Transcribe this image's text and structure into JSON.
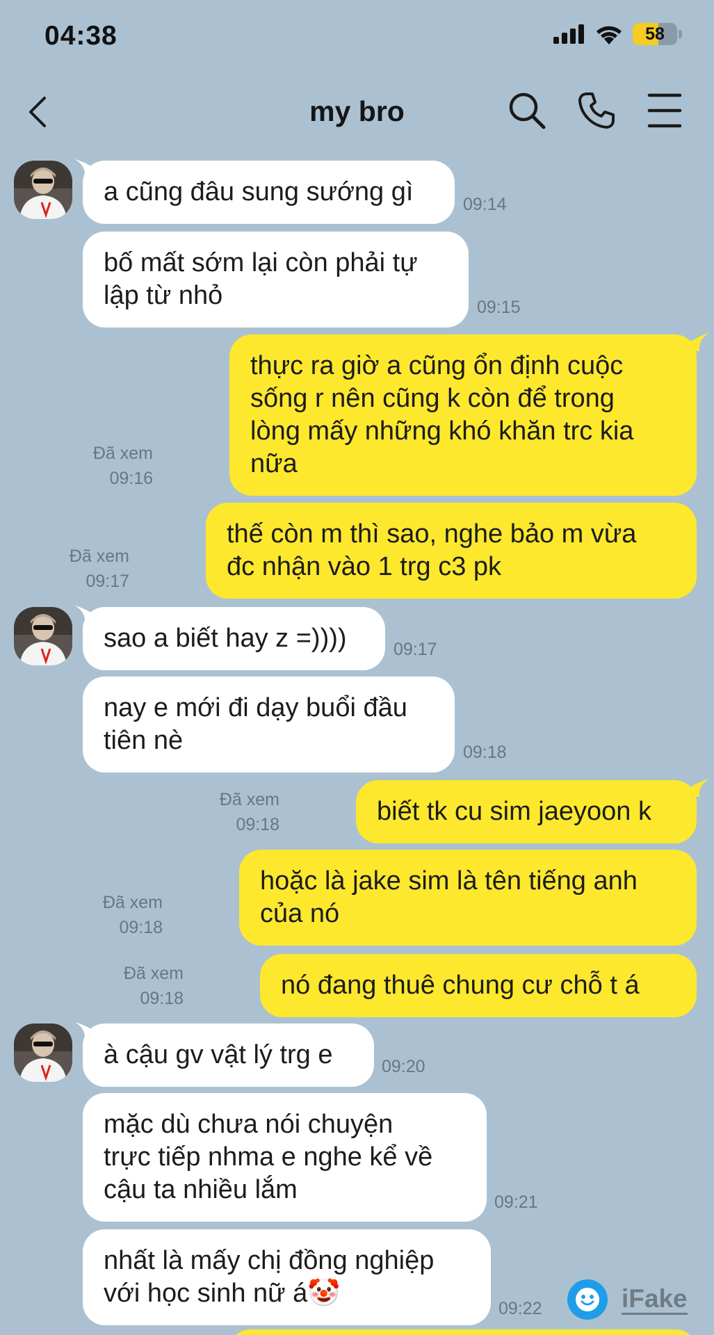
{
  "status_bar": {
    "time": "04:38",
    "battery": "58",
    "battery_level": 0.58
  },
  "header": {
    "title": "my bro"
  },
  "messages": [
    {
      "side": "in",
      "text": "a cũng đâu sung sướng gì",
      "time": "09:14"
    },
    {
      "side": "in",
      "text": "bố mất sớm lại còn phải tự\nlập từ nhỏ",
      "time": "09:15"
    },
    {
      "side": "out",
      "text": "thực ra giờ a cũng ổn định cuộc\nsống r nên cũng k còn để trong\nlòng mấy những khó khăn trc kia\nnữa",
      "read": "Đã xem",
      "time": "09:16"
    },
    {
      "side": "out",
      "text": "thế còn m thì sao, nghe bảo m vừa\nđc nhận vào 1 trg c3 pk",
      "read": "Đã xem",
      "time": "09:17"
    },
    {
      "side": "in",
      "text": "sao a biết hay z =))))",
      "time": "09:17"
    },
    {
      "side": "in",
      "text": "nay e mới đi dạy buổi đầu\ntiên nè",
      "time": "09:18"
    },
    {
      "side": "out",
      "text": "biết tk cu sim jaeyoon k",
      "read": "Đã xem",
      "time": "09:18"
    },
    {
      "side": "out",
      "text": "hoặc là jake sim là tên tiếng anh\ncủa nó",
      "read": "Đã xem",
      "time": "09:18"
    },
    {
      "side": "out",
      "text": "nó đang thuê chung cư chỗ t á",
      "read": "Đã xem",
      "time": "09:18"
    },
    {
      "side": "in",
      "text": "à cậu gv vật lý trg e",
      "time": "09:20"
    },
    {
      "side": "in",
      "text": "mặc dù chưa nói chuyện\ntrực tiếp nhma e nghe kể về\ncậu ta nhiều lắm",
      "time": "09:21"
    },
    {
      "side": "in",
      "text": "nhất là mấy chị đồng nghiệp\nvới học sinh nữ á🤡",
      "time": "09:22"
    }
  ],
  "watermark": {
    "text": "iFake"
  },
  "icons": {
    "back": "chevron-left-icon",
    "search": "search-icon",
    "call": "phone-icon",
    "menu": "menu-icon",
    "signal": "signal-icon",
    "wifi": "wifi-icon",
    "battery": "battery-icon"
  },
  "colors": {
    "background": "#abc1d1",
    "outgoing_bubble": "#fde82e",
    "incoming_bubble": "#ffffff",
    "meta_text": "#6a7680"
  }
}
